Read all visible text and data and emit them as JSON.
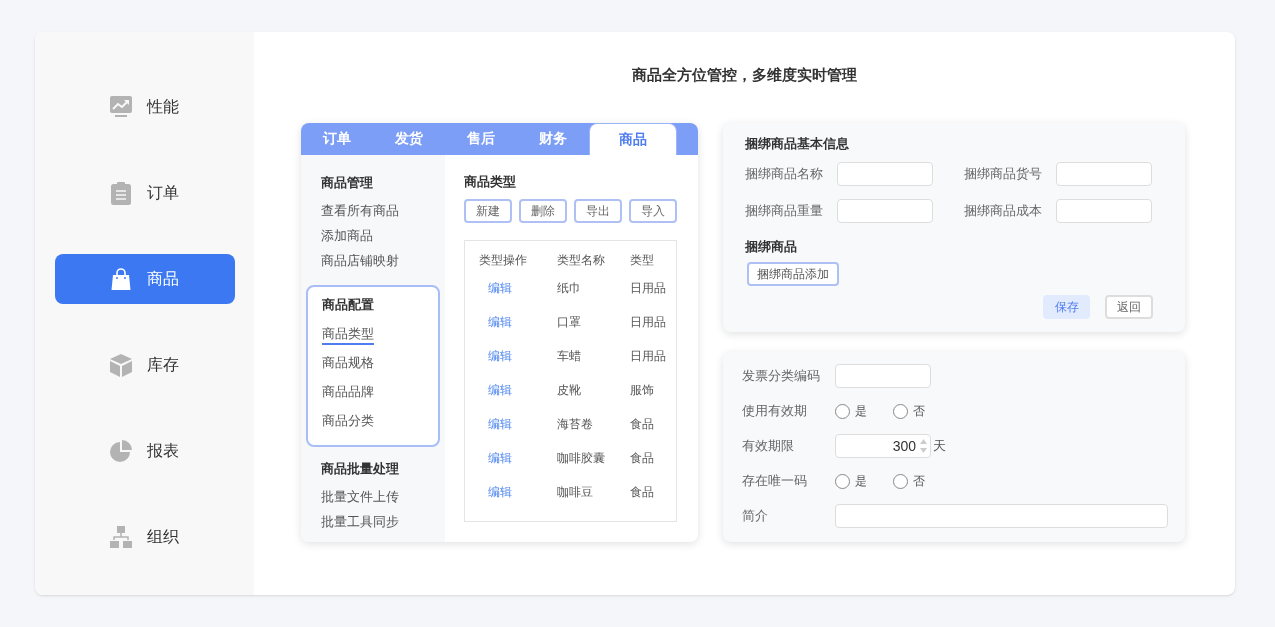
{
  "sidebar": {
    "items": [
      {
        "label": "性能",
        "selected": false
      },
      {
        "label": "订单",
        "selected": false
      },
      {
        "label": "商品",
        "selected": true
      },
      {
        "label": "库存",
        "selected": false
      },
      {
        "label": "报表",
        "selected": false
      },
      {
        "label": "组织",
        "selected": false
      }
    ]
  },
  "title": "商品全方位管控，多维度实时管理",
  "tabs": [
    {
      "label": "订单",
      "selected": false
    },
    {
      "label": "发货",
      "selected": false
    },
    {
      "label": "售后",
      "selected": false
    },
    {
      "label": "财务",
      "selected": false
    },
    {
      "label": "商品",
      "selected": true
    }
  ],
  "nav_groups": [
    {
      "title": "商品管理",
      "highlighted": false,
      "items": [
        {
          "label": "查看所有商品",
          "selected": false
        },
        {
          "label": "添加商品",
          "selected": false
        },
        {
          "label": "商品店铺映射",
          "selected": false
        }
      ]
    },
    {
      "title": "商品配置",
      "highlighted": true,
      "items": [
        {
          "label": "商品类型",
          "selected": true
        },
        {
          "label": "商品规格",
          "selected": false
        },
        {
          "label": "商品品牌",
          "selected": false
        },
        {
          "label": "商品分类",
          "selected": false
        }
      ]
    },
    {
      "title": "商品批量处理",
      "highlighted": false,
      "items": [
        {
          "label": "批量文件上传",
          "selected": false
        },
        {
          "label": "批量工具同步",
          "selected": false
        }
      ]
    }
  ],
  "type_panel": {
    "title": "商品类型",
    "buttons": [
      "新建",
      "删除",
      "导出",
      "导入"
    ],
    "table": {
      "columns": [
        "类型操作",
        "类型名称",
        "类型"
      ],
      "rows": [
        [
          "编辑",
          "纸巾",
          "日用品"
        ],
        [
          "编辑",
          "口罩",
          "日用品"
        ],
        [
          "编辑",
          "车蜡",
          "日用品"
        ],
        [
          "编辑",
          "皮靴",
          "服饰"
        ],
        [
          "编辑",
          "海苔卷",
          "食品"
        ],
        [
          "编辑",
          "咖啡胶囊",
          "食品"
        ],
        [
          "编辑",
          "咖啡豆",
          "食品"
        ]
      ]
    }
  },
  "bundle_form": {
    "title": "捆绑商品基本信息",
    "fields": [
      {
        "label": "捆绑商品名称"
      },
      {
        "label": "捆绑商品货号"
      },
      {
        "label": "捆绑商品重量"
      },
      {
        "label": "捆绑商品成本"
      }
    ],
    "section": "捆绑商品",
    "add_button": "捆绑商品添加",
    "save_button": "保存",
    "back_button": "返回"
  },
  "extra_form": {
    "rows": [
      {
        "kind": "text",
        "label": "发票分类编码"
      },
      {
        "kind": "radio",
        "label": "使用有效期",
        "options": [
          {
            "label": "是",
            "checked": false
          },
          {
            "label": "否",
            "checked": false
          }
        ]
      },
      {
        "kind": "number",
        "label": "有效期限",
        "value": "300",
        "unit": "天"
      },
      {
        "kind": "radio",
        "label": "存在唯一码",
        "options": [
          {
            "label": "是",
            "checked": false
          },
          {
            "label": "否",
            "checked": false
          }
        ]
      },
      {
        "kind": "wide",
        "label": "简介"
      }
    ]
  }
}
